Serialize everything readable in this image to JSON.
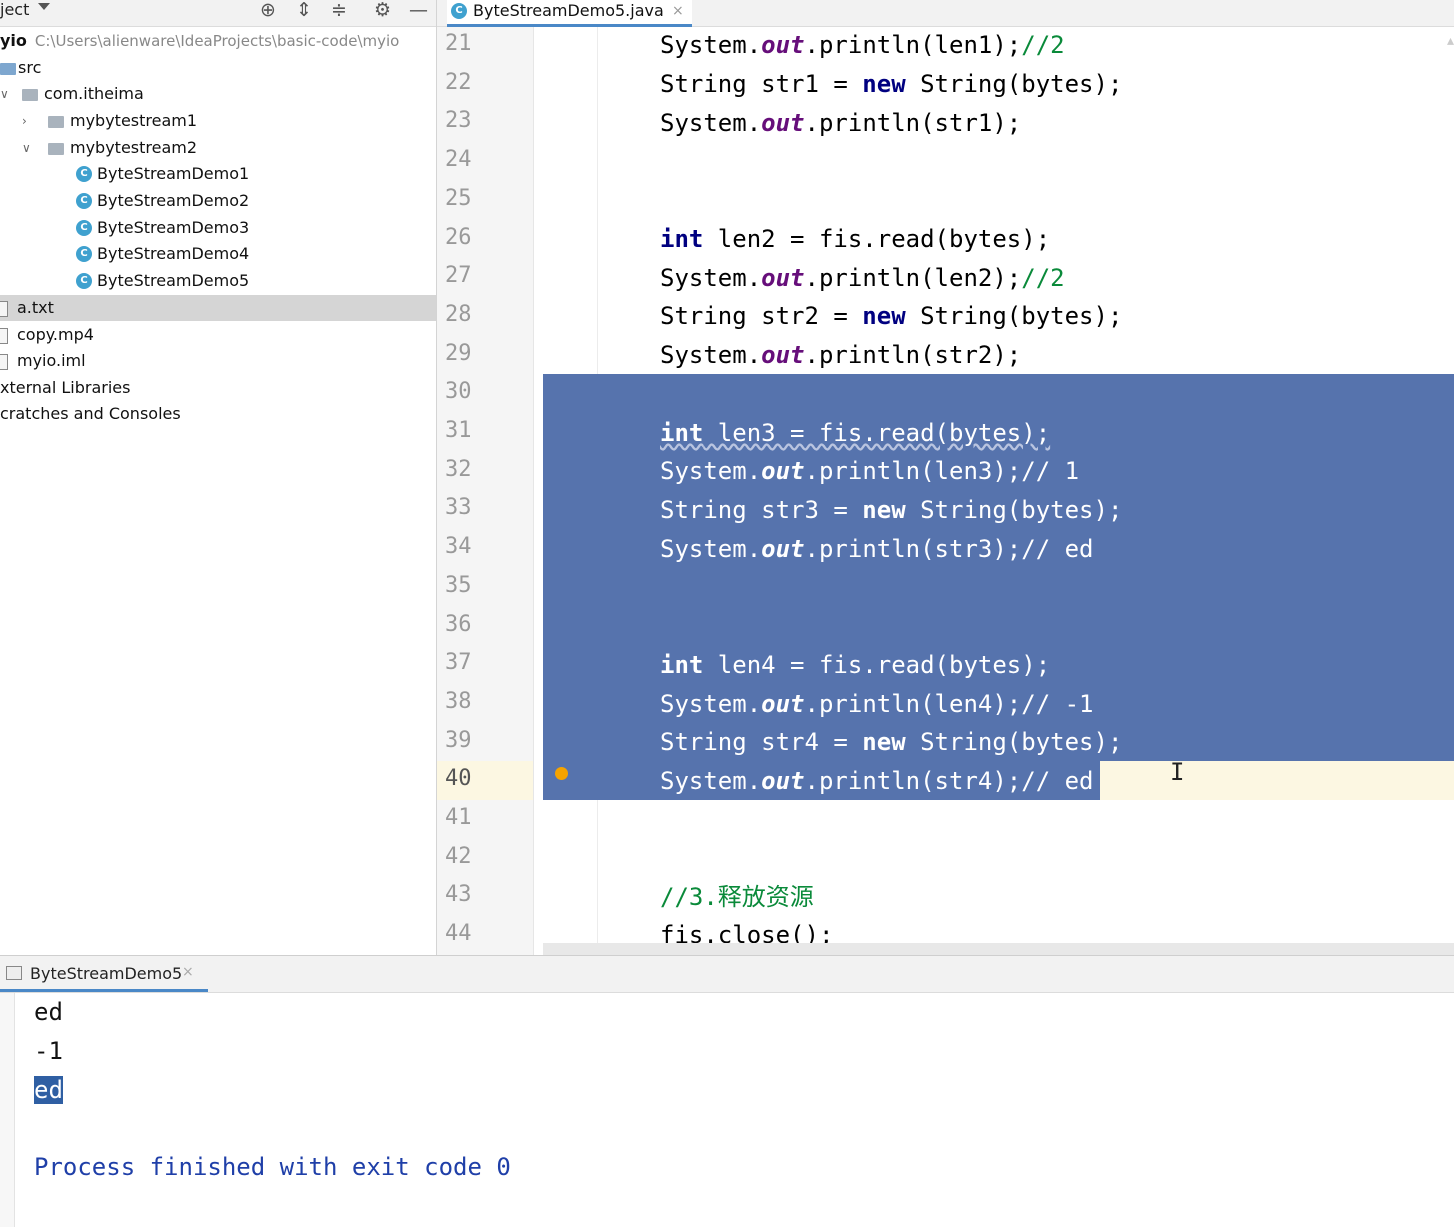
{
  "project_panel": {
    "title": "ject",
    "toolbar_icons": [
      "crosshair-icon",
      "expand-all-icon",
      "collapse-all-icon",
      "gear-icon",
      "minimize-icon"
    ],
    "root_name": "yio",
    "root_path": "C:\\Users\\alienware\\IdeaProjects\\basic-code\\myio",
    "tree": {
      "src": "src",
      "pkg": "com.itheima",
      "pkg1": "mybytestream1",
      "pkg2": "mybytestream2",
      "classes": [
        "ByteStreamDemo1",
        "ByteStreamDemo2",
        "ByteStreamDemo3",
        "ByteStreamDemo4",
        "ByteStreamDemo5"
      ],
      "files": [
        "a.txt",
        "copy.mp4",
        "myio.iml"
      ],
      "external": "xternal Libraries",
      "scratches": "cratches and Consoles"
    }
  },
  "editor": {
    "tab_label": "ByteStreamDemo5.java",
    "line_numbers": [
      "21",
      "22",
      "23",
      "24",
      "25",
      "26",
      "27",
      "28",
      "29",
      "30",
      "31",
      "32",
      "33",
      "34",
      "35",
      "36",
      "37",
      "38",
      "39",
      "40",
      "41",
      "42",
      "43",
      "44"
    ],
    "current_line": "40",
    "code": {
      "l21a": "System.",
      "l21b": "out",
      "l21c": ".println(len1);",
      "l21d": "//2",
      "l22a": "String str1 = ",
      "l22b": "new",
      "l22c": " String(bytes);",
      "l23a": "System.",
      "l23b": "out",
      "l23c": ".println(str1);",
      "l26a": "int",
      "l26b": " len2 = fis.read(bytes);",
      "l27a": "System.",
      "l27b": "out",
      "l27c": ".println(len2);",
      "l27d": "//2",
      "l28a": "String str2 = ",
      "l28b": "new",
      "l28c": " String(bytes);",
      "l29a": "System.",
      "l29b": "out",
      "l29c": ".println(str2);",
      "l31a": "int",
      "l31b": " len3 = fis.read(bytes);",
      "l32a": "System.",
      "l32b": "out",
      "l32c": ".println(len3);// 1",
      "l33a": "String str3 = ",
      "l33b": "new",
      "l33c": " String(bytes);",
      "l34a": "System.",
      "l34b": "out",
      "l34c": ".println(str3);// ed",
      "l37a": "int",
      "l37b": " len4 = fis.read(bytes);",
      "l38a": "System.",
      "l38b": "out",
      "l38c": ".println(len4);// -1",
      "l39a": "String str4 = ",
      "l39b": "new",
      "l39c": " String(bytes);",
      "l40a": "System.",
      "l40b": "out",
      "l40c": ".println(str4);// ed",
      "l43": "//3.释放资源",
      "l44": "fis.close();"
    }
  },
  "run_panel": {
    "tab_label": "ByteStreamDemo5",
    "output": [
      "ed",
      "-1",
      "ed"
    ],
    "process_message": "Process finished with exit code 0"
  },
  "colors": {
    "selection": "#5673ad",
    "keyword": "#000080",
    "field": "#660e7a",
    "comment": "#0a8a3a",
    "current_line": "#fcf7e2",
    "breakpoint": "#f5a300"
  }
}
